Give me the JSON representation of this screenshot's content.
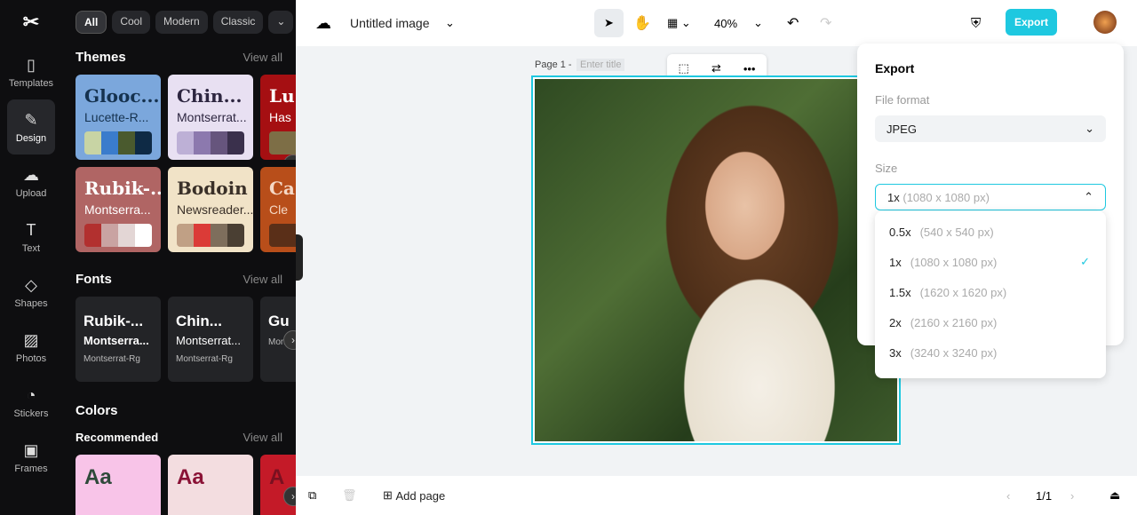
{
  "rail": {
    "items": [
      {
        "label": "Templates",
        "icon": "templates-icon"
      },
      {
        "label": "Design",
        "icon": "design-icon"
      },
      {
        "label": "Upload",
        "icon": "upload-icon"
      },
      {
        "label": "Text",
        "icon": "text-icon"
      },
      {
        "label": "Shapes",
        "icon": "shapes-icon"
      },
      {
        "label": "Photos",
        "icon": "photos-icon"
      },
      {
        "label": "Stickers",
        "icon": "stickers-icon"
      },
      {
        "label": "Frames",
        "icon": "frames-icon"
      }
    ]
  },
  "panel": {
    "chips": [
      "All",
      "Cool",
      "Modern",
      "Classic"
    ],
    "themes": {
      "title": "Themes",
      "view_all": "View all",
      "cards": [
        {
          "t1": "Glooc...",
          "t2": "Lucette-R...",
          "bg": "#7ba7dc",
          "fg": "#15324f",
          "colors": [
            "#c8d4a4",
            "#3a7ccc",
            "#4a5a2e",
            "#0e2a45"
          ]
        },
        {
          "t1": "Chin...",
          "t2": "Montserrat...",
          "bg": "#e8e0f2",
          "fg": "#2d2640",
          "colors": [
            "#bdb0d6",
            "#8c79ae",
            "#66557d",
            "#3a304c"
          ]
        },
        {
          "t1": "Lu",
          "t2": "Has",
          "bg": "#a50f12",
          "fg": "#fff",
          "colors": [
            "#7d6e46",
            "#7d6e46",
            "#7d6e46",
            "#7d6e46"
          ]
        },
        {
          "t1": "Rubik-...",
          "t2": "Montserra...",
          "bg": "#b06564",
          "fg": "#fff",
          "colors": [
            "#b2302f",
            "#c9a3a2",
            "#e3d6d5",
            "#ffffff"
          ]
        },
        {
          "t1": "Bodoin Mo...",
          "t2": "Newsreader...",
          "bg": "#f1e3c7",
          "fg": "#3a3028",
          "colors": [
            "#c0a085",
            "#db3b37",
            "#7e6e5c",
            "#4a3f33"
          ]
        },
        {
          "t1": "Ca",
          "t2": "Cle",
          "bg": "#b84e1a",
          "fg": "#f5d8c5",
          "colors": [
            "#5a2f18",
            "#5a2f18",
            "#5a2f18",
            "#5a2f18"
          ]
        }
      ]
    },
    "fonts": {
      "title": "Fonts",
      "view_all": "View all",
      "cards": [
        {
          "a": "Rubik-...",
          "b": "Montserra...",
          "c": "Montserrat-Rg"
        },
        {
          "a": "Chin...",
          "b": "Montserrat...",
          "c": "Montserrat-Rg"
        },
        {
          "a": "Gu",
          "b": "",
          "c": "Mon"
        }
      ]
    },
    "colors": {
      "title": "Colors",
      "recommended": "Recommended",
      "view_all": "View all",
      "cards": [
        {
          "label": "Aa",
          "bg": "#f8c4e8",
          "fg": "#2e4a3a"
        },
        {
          "label": "Aa",
          "bg": "#f3dde0",
          "fg": "#8a1236"
        },
        {
          "label": "A",
          "bg": "#c41a28",
          "fg": "#7a1020"
        }
      ]
    }
  },
  "header": {
    "title": "Untitled image",
    "zoom": "40%",
    "export": "Export"
  },
  "page": {
    "label": "Page 1 -",
    "title_placeholder": "Enter title"
  },
  "export_panel": {
    "title": "Export",
    "format_label": "File format",
    "format_value": "JPEG",
    "size_label": "Size",
    "size_value": "1x",
    "size_px": "(1080 x 1080 px)",
    "options": [
      {
        "scale": "0.5x",
        "px": "(540 x 540 px)",
        "selected": false
      },
      {
        "scale": "1x",
        "px": "(1080 x 1080 px)",
        "selected": true
      },
      {
        "scale": "1.5x",
        "px": "(1620 x 1620 px)",
        "selected": false
      },
      {
        "scale": "2x",
        "px": "(2160 x 2160 px)",
        "selected": false
      },
      {
        "scale": "3x",
        "px": "(3240 x 3240 px)",
        "selected": false
      }
    ]
  },
  "footer": {
    "add_page": "Add page",
    "page_count": "1/1"
  },
  "colors": {
    "accent": "#1ec8e0"
  }
}
